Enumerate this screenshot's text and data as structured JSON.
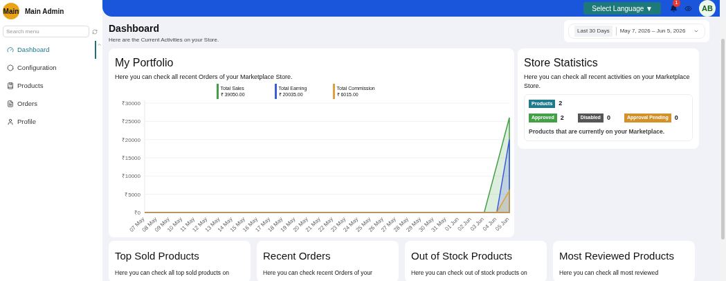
{
  "sidebar": {
    "logo_text": "Main",
    "user_name": "Main Admin",
    "search": {
      "placeholder": "Search menu"
    },
    "items": [
      {
        "label": "Dashboard",
        "selected": true
      },
      {
        "label": "Configuration",
        "selected": false
      },
      {
        "label": "Products",
        "selected": false
      },
      {
        "label": "Orders",
        "selected": false
      },
      {
        "label": "Profile",
        "selected": false
      }
    ]
  },
  "header": {
    "language_button": "Select Language ▼",
    "notification_count": "1",
    "avatar": "AB"
  },
  "page": {
    "title": "Dashboard",
    "subtitle": "Here are the Current Activities on your Store.",
    "date_range": {
      "preset": "Last 30 Days",
      "range": "May 7, 2026 – Jun 5, 2026"
    }
  },
  "portfolio": {
    "title": "My Portfolio",
    "subtitle": "Here you can check all recent Orders of your Marketplace Store.",
    "legend_amounts": [
      "₹ 39050.00",
      "₹ 20035.00",
      "₹ 6015.00"
    ],
    "chart_data": {
      "type": "area",
      "categories": [
        "07 May",
        "08 May",
        "09 May",
        "10 May",
        "11 May",
        "12 May",
        "13 May",
        "14 May",
        "15 May",
        "16 May",
        "17 May",
        "18 May",
        "19 May",
        "20 May",
        "21 May",
        "22 May",
        "23 May",
        "24 May",
        "25 May",
        "26 May",
        "27 May",
        "28 May",
        "29 May",
        "30 May",
        "31 May",
        "01 Jun",
        "02 Jun",
        "03 Jun",
        "04 Jun",
        "05 Jun"
      ],
      "ylim": [
        0,
        30000
      ],
      "grid": true,
      "yticks": [
        {
          "value": 0,
          "label": "₹0"
        },
        {
          "value": 5000,
          "label": "₹5000"
        },
        {
          "value": 10000,
          "label": "₹10000"
        },
        {
          "value": 15000,
          "label": "₹15000"
        },
        {
          "value": 20000,
          "label": "₹20000"
        },
        {
          "value": 25000,
          "label": "₹25000"
        },
        {
          "value": 30000,
          "label": "₹30000"
        }
      ],
      "series": [
        {
          "name": "Total Sales",
          "color": "#43a047",
          "values": [
            0,
            0,
            0,
            0,
            0,
            0,
            0,
            0,
            0,
            0,
            0,
            0,
            0,
            0,
            0,
            0,
            0,
            0,
            0,
            0,
            0,
            0,
            0,
            0,
            0,
            0,
            0,
            0,
            13000,
            26000
          ]
        },
        {
          "name": "Total Earning",
          "color": "#3b5bdb",
          "values": [
            0,
            0,
            0,
            0,
            0,
            0,
            0,
            0,
            0,
            0,
            0,
            0,
            0,
            0,
            0,
            0,
            0,
            0,
            0,
            0,
            0,
            0,
            0,
            0,
            0,
            0,
            0,
            0,
            0,
            20000
          ]
        },
        {
          "name": "Total Commission",
          "color": "#e0a040",
          "values": [
            0,
            0,
            0,
            0,
            0,
            0,
            0,
            0,
            0,
            0,
            0,
            0,
            0,
            0,
            0,
            0,
            0,
            0,
            0,
            0,
            0,
            0,
            0,
            0,
            0,
            0,
            0,
            0,
            0,
            6000
          ]
        }
      ]
    }
  },
  "store_statistics": {
    "title": "Store Statistics",
    "subtitle": "Here you can check all recent activities on your Marketplace Store.",
    "stats": [
      {
        "label": "Products",
        "count": "2",
        "color": "#1f7a8c"
      },
      {
        "label": "Approved",
        "count": "2",
        "color": "#43a047"
      },
      {
        "label": "Disabled",
        "count": "0",
        "color": "#555555"
      },
      {
        "label": "Approval Pending",
        "count": "0",
        "color": "#d4912a"
      }
    ],
    "footer": "Products that are currently on your Marketplace."
  },
  "cards": [
    {
      "title": "Top Sold Products",
      "subtitle": "Here you can check all top sold products on"
    },
    {
      "title": "Recent Orders",
      "subtitle": "Here you can check recent Orders of your"
    },
    {
      "title": "Out of Stock Products",
      "subtitle": "Here you can check out of stock products on"
    },
    {
      "title": "Most Reviewed Products",
      "subtitle": "Here you can check all most reviewed"
    }
  ]
}
